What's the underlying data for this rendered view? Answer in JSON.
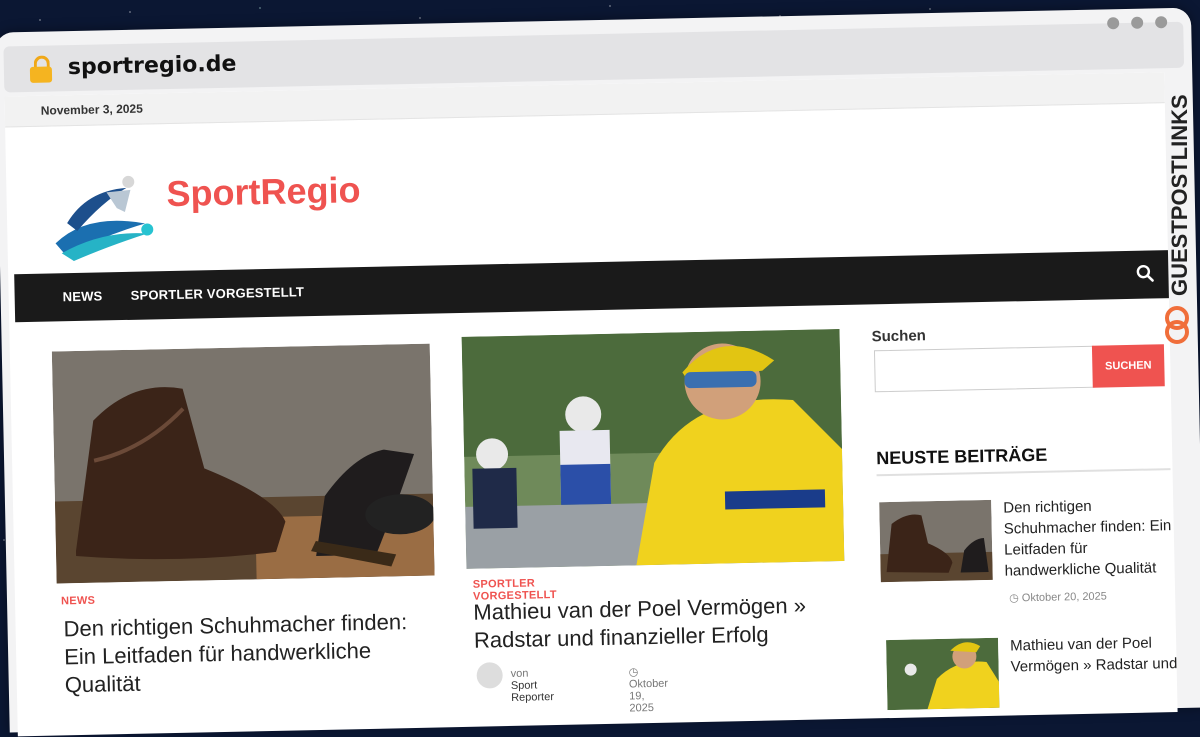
{
  "browser": {
    "url": "sportregio.de"
  },
  "site": {
    "date": "November 3, 2025",
    "title": "SportRegio",
    "accent": "#ef5350"
  },
  "nav": {
    "items": [
      "NEWS",
      "SPORTLER VORGESTELLT"
    ],
    "search_icon": "search-icon"
  },
  "articles": [
    {
      "category": "NEWS",
      "title": "Den richtigen Schuhmacher finden: Ein Leitfaden für handwerkliche Qualität"
    },
    {
      "category": "SPORTLER VORGESTELLT",
      "title": "Mathieu van der Poel Vermögen » Radstar und finanzieller Erfolg",
      "author_prefix": "von",
      "author": "Sport Reporter",
      "date": "Oktober 19, 2025"
    }
  ],
  "sidebar": {
    "search_label": "Suchen",
    "search_button": "SUCHEN",
    "recent_title": "NEUSTE BEITRÄGE",
    "recent": [
      {
        "title": "Den richtigen Schuhmacher finden: Ein Leitfaden für handwerkliche Qualität",
        "date": "Oktober 20, 2025"
      },
      {
        "title": "Mathieu van der Poel Vermögen » Radstar und"
      }
    ]
  },
  "watermark": {
    "text": "GUESTPOSTLINKS"
  }
}
